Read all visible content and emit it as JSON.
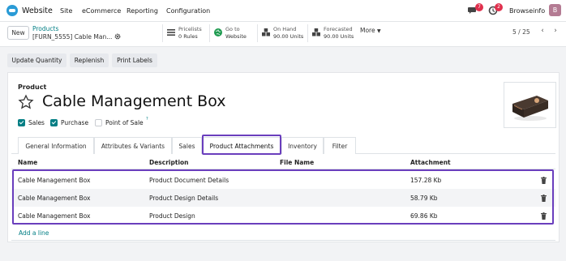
{
  "navbar": {
    "app_title": "Website",
    "menu": [
      "Site",
      "eCommerce",
      "Reporting",
      "Configuration"
    ],
    "messages_badge": "7",
    "activities_badge": "2",
    "company": "Browseinfo",
    "avatar_letter": "B"
  },
  "control_panel": {
    "new_label": "New",
    "breadcrumb_parent": "Products",
    "breadcrumb_current": "[FURN_5555] Cable Man...",
    "smart_buttons": [
      {
        "line1": "Pricelists",
        "line2": "0 Rules",
        "icon": "list-icon"
      },
      {
        "line1": "Go to",
        "line2": "Website",
        "icon": "globe-icon"
      },
      {
        "line1": "On Hand",
        "line2": "90.00 Units",
        "icon": "cubes-icon"
      },
      {
        "line1": "Forecasted",
        "line2": "90.00 Units",
        "icon": "forecast-icon"
      }
    ],
    "more_label": "More",
    "pager": "5 / 25"
  },
  "actions": [
    "Update Quantity",
    "Replenish",
    "Print Labels"
  ],
  "form": {
    "product_label": "Product",
    "product_name": "Cable Management Box",
    "checkboxes": [
      {
        "label": "Sales",
        "checked": true
      },
      {
        "label": "Purchase",
        "checked": true
      },
      {
        "label": "Point of Sale",
        "checked": false
      }
    ],
    "pos_tooltip": "?"
  },
  "tabs": [
    "General Information",
    "Attributes & Variants",
    "Sales",
    "Product Attachments",
    "Inventory",
    "Filter"
  ],
  "active_tab": "Product Attachments",
  "table": {
    "headers": [
      "Name",
      "Description",
      "File Name",
      "Attachment"
    ],
    "rows": [
      [
        "Cable Management Box",
        "Product Document Details",
        "",
        "157.28 Kb"
      ],
      [
        "Cable Management Box",
        "Product Design Details",
        "",
        "58.79 Kb"
      ],
      [
        "Cable Management Box",
        "Product Design",
        "",
        "69.86 Kb"
      ]
    ],
    "add_line": "Add a line"
  },
  "colors": {
    "accent": "#017e84",
    "highlight": "#6a3ebd",
    "badge": "#e0304d"
  }
}
